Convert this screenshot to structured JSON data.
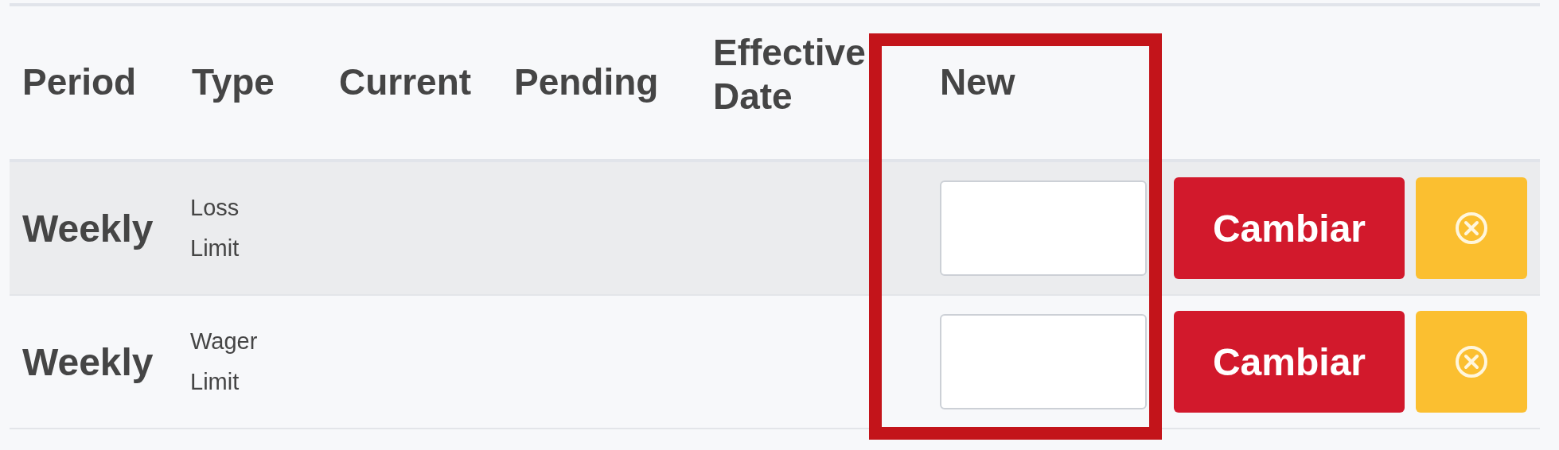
{
  "table": {
    "columns": [
      "Period",
      "Type",
      "Current",
      "Pending",
      "Effective Date",
      "New"
    ],
    "rows": [
      {
        "period": "Weekly",
        "type": "Loss Limit",
        "action": "Cambiar"
      },
      {
        "period": "Weekly",
        "type": "Wager Limit",
        "action": "Cambiar"
      }
    ]
  },
  "highlight": {
    "kind": "box"
  }
}
